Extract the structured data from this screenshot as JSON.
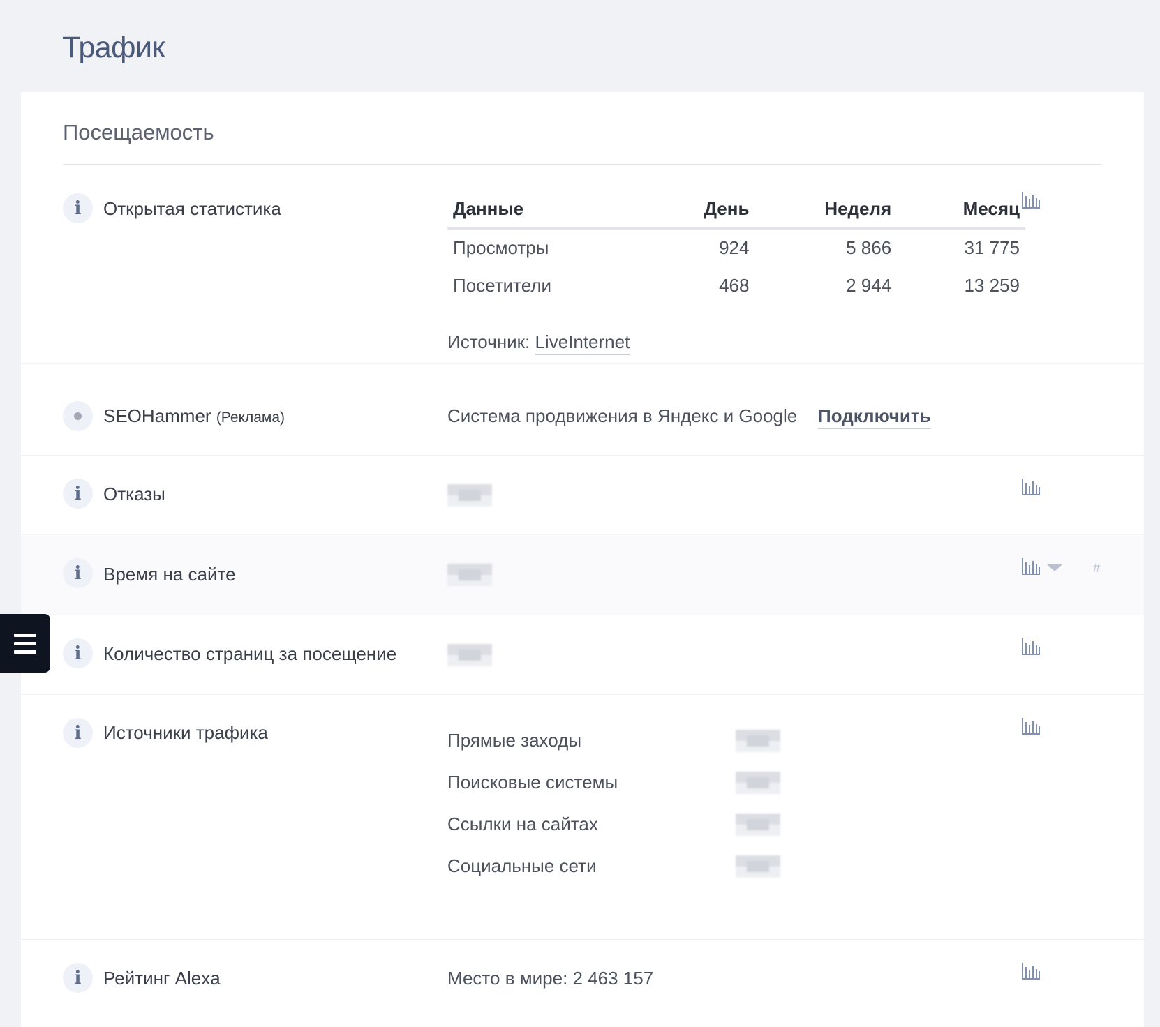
{
  "page": {
    "title": "Трафик"
  },
  "section": {
    "title": "Посещаемость"
  },
  "open_stats": {
    "label": "Открытая статистика",
    "table": {
      "headers": [
        "Данные",
        "День",
        "Неделя",
        "Месяц"
      ],
      "rows": [
        [
          "Просмотры",
          "924",
          "5 866",
          "31 775"
        ],
        [
          "Посетители",
          "468",
          "2 944",
          "13 259"
        ]
      ]
    },
    "source_prefix": "Источник:",
    "source_link": "LiveInternet"
  },
  "seohammer": {
    "label": "SEOHammer",
    "ad_note": "(Реклама)",
    "description": "Система продвижения в Яндекс и Google",
    "connect": "Подключить"
  },
  "bounces": {
    "label": "Отказы"
  },
  "time_on_site": {
    "label": "Время на сайте",
    "hash": "#"
  },
  "pages_per_visit": {
    "label": "Количество страниц за посещение"
  },
  "traffic_sources": {
    "label": "Источники трафика",
    "items": [
      "Прямые заходы",
      "Поисковые системы",
      "Ссылки на сайтах",
      "Социальные сети"
    ]
  },
  "alexa": {
    "label": "Рейтинг Alexa",
    "world_rank": "Место в мире: 2 463 157"
  },
  "icons": {
    "info": "i",
    "chart": "bar-chart-icon",
    "menu": "hamburger-menu-icon",
    "dropdown": "chevron-down-icon"
  },
  "colors": {
    "page_bg": "#f1f2f6",
    "card_bg": "#ffffff",
    "title": "#4a5a7c",
    "icon": "#5d6d90",
    "menu_bg": "#0e1521"
  }
}
